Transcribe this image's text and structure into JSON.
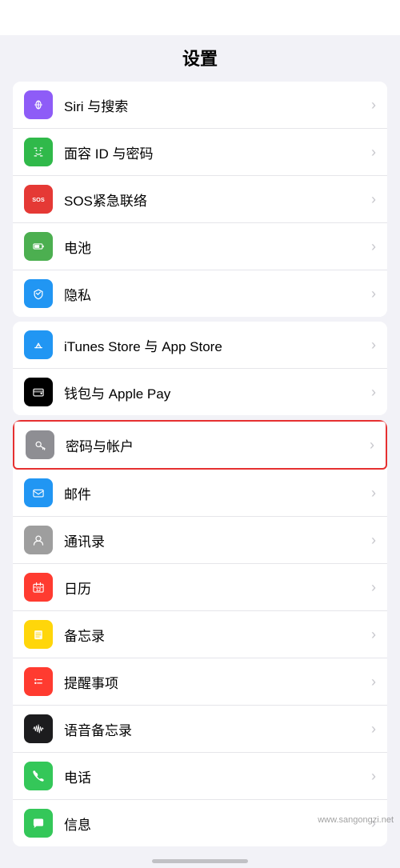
{
  "page": {
    "title": "设置"
  },
  "groups": [
    {
      "id": "group1",
      "items": [
        {
          "id": "siri",
          "label": "Siri 与搜索",
          "iconBg": "#8e5cf7",
          "iconType": "siri",
          "badge": null,
          "highlighted": false
        },
        {
          "id": "faceid",
          "label": "面容 ID 与密码",
          "iconBg": "#30b94a",
          "iconType": "faceid",
          "badge": null,
          "highlighted": false
        },
        {
          "id": "sos",
          "label": "SOS紧急联络",
          "iconBg": "#e53935",
          "iconType": "sos",
          "badge": null,
          "highlighted": false
        },
        {
          "id": "battery",
          "label": "电池",
          "iconBg": "#4caf50",
          "iconType": "battery",
          "badge": null,
          "highlighted": false
        },
        {
          "id": "privacy",
          "label": "隐私",
          "iconBg": "#2196f3",
          "iconType": "privacy",
          "badge": null,
          "highlighted": false
        }
      ]
    },
    {
      "id": "group2",
      "items": [
        {
          "id": "itunes",
          "label": "iTunes Store 与 App Store",
          "iconBg": "#2196f3",
          "iconType": "appstore",
          "badge": null,
          "highlighted": false
        },
        {
          "id": "wallet",
          "label": "钱包与 Apple Pay",
          "iconBg": "#000000",
          "iconType": "wallet",
          "badge": null,
          "highlighted": false
        }
      ]
    },
    {
      "id": "group3",
      "items": [
        {
          "id": "passwords",
          "label": "密码与帐户",
          "iconBg": "#8e8e93",
          "iconType": "key",
          "badge": null,
          "highlighted": true
        },
        {
          "id": "mail",
          "label": "邮件",
          "iconBg": "#2196f3",
          "iconType": "mail",
          "badge": null,
          "highlighted": false
        },
        {
          "id": "contacts",
          "label": "通讯录",
          "iconBg": "#9e9e9e",
          "iconType": "contacts",
          "badge": null,
          "highlighted": false
        },
        {
          "id": "calendar",
          "label": "日历",
          "iconBg": "#ff3b30",
          "iconType": "calendar",
          "badge": null,
          "highlighted": false
        },
        {
          "id": "notes",
          "label": "备忘录",
          "iconBg": "#ffd60a",
          "iconType": "notes",
          "badge": null,
          "highlighted": false
        },
        {
          "id": "reminders",
          "label": "提醒事项",
          "iconBg": "#ff3b30",
          "iconType": "reminders",
          "badge": null,
          "highlighted": false
        },
        {
          "id": "voicememo",
          "label": "语音备忘录",
          "iconBg": "#1c1c1e",
          "iconType": "voicememo",
          "badge": null,
          "highlighted": false
        },
        {
          "id": "phone",
          "label": "电话",
          "iconBg": "#34c759",
          "iconType": "phone",
          "badge": null,
          "highlighted": false
        },
        {
          "id": "messages",
          "label": "信息",
          "iconBg": "#34c759",
          "iconType": "messages",
          "badge": null,
          "highlighted": false
        }
      ]
    }
  ],
  "watermark": "www.sangongzi.net"
}
